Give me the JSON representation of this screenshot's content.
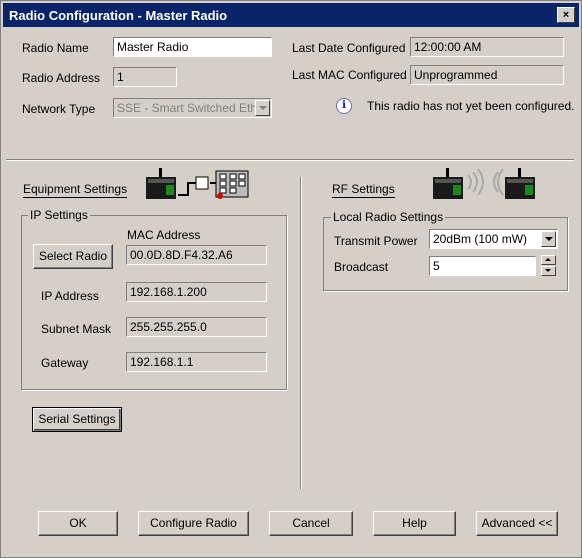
{
  "window": {
    "title": "Radio Configuration - Master Radio"
  },
  "top": {
    "radio_name_label": "Radio Name",
    "radio_name_value": "Master Radio",
    "radio_address_label": "Radio Address",
    "radio_address_value": "1",
    "network_type_label": "Network Type",
    "network_type_value": "SSE - Smart Switched Eth",
    "last_date_label": "Last Date Configured",
    "last_date_value": "12:00:00 AM",
    "last_mac_label": "Last MAC Configured",
    "last_mac_value": "Unprogrammed",
    "info_message": "This radio has not yet been configured."
  },
  "equipment": {
    "label": "Equipment Settings",
    "ip_group_title": "IP Settings",
    "mac_address_label": "MAC Address",
    "select_radio_button": "Select Radio",
    "mac_address_value": "00.0D.8D.F4.32.A6",
    "ip_address_label": "IP Address",
    "ip_address_value": "192.168.1.200",
    "subnet_mask_label": "Subnet Mask",
    "subnet_mask_value": "255.255.255.0",
    "gateway_label": "Gateway",
    "gateway_value": "192.168.1.1",
    "serial_settings_button": "Serial Settings"
  },
  "rf": {
    "label": "RF Settings",
    "local_group_title": "Local Radio Settings",
    "transmit_power_label": "Transmit Power",
    "transmit_power_value": "20dBm (100 mW)",
    "broadcast_label": "Broadcast",
    "broadcast_value": "5"
  },
  "buttons": {
    "ok": "OK",
    "configure": "Configure Radio",
    "cancel": "Cancel",
    "help": "Help",
    "advanced": "Advanced <<"
  },
  "colors": {
    "titlebar": "#0a246a",
    "dialog_bg": "#d4d0c8",
    "device_green": "#1a8a1a",
    "device_red": "#e00000"
  }
}
